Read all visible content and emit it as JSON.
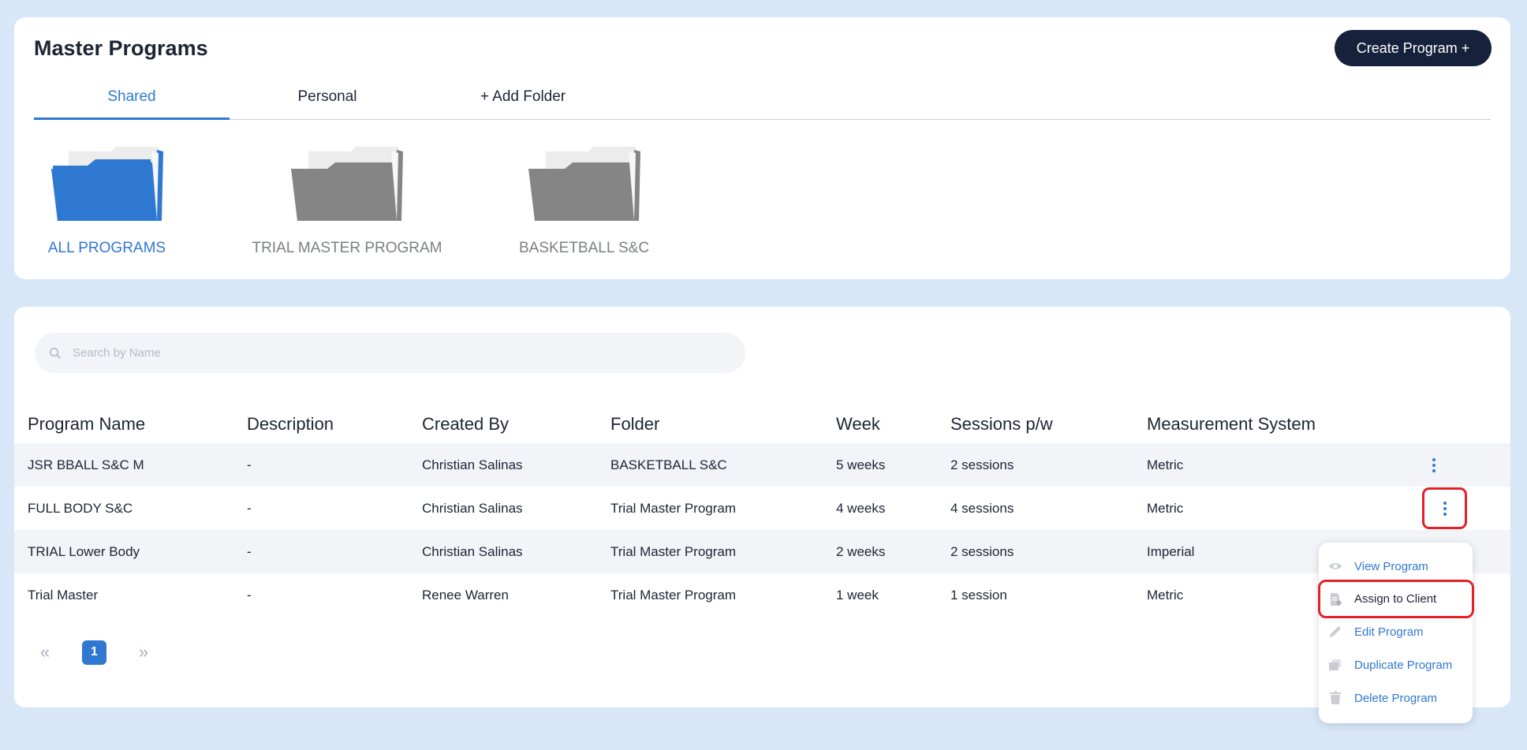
{
  "header": {
    "title": "Master Programs",
    "create_button": "Create Program +"
  },
  "tabs": [
    {
      "label": "Shared",
      "active": true
    },
    {
      "label": "Personal",
      "active": false
    },
    {
      "label": "+ Add Folder",
      "active": false
    }
  ],
  "folders": [
    {
      "label": "ALL PROGRAMS",
      "active": true
    },
    {
      "label": "TRIAL MASTER PROGRAM",
      "active": false
    },
    {
      "label": "BASKETBALL S&C",
      "active": false
    }
  ],
  "search": {
    "placeholder": "Search by Name",
    "value": ""
  },
  "table": {
    "columns": [
      "Program Name",
      "Description",
      "Created By",
      "Folder",
      "Week",
      "Sessions p/w",
      "Measurement System"
    ],
    "rows": [
      [
        "JSR BBALL S&C M",
        "-",
        "Christian Salinas",
        "BASKETBALL S&C",
        "5 weeks",
        "2 sessions",
        "Metric"
      ],
      [
        "FULL BODY S&C",
        "-",
        "Christian Salinas",
        "Trial Master Program",
        "4 weeks",
        "4 sessions",
        "Metric"
      ],
      [
        "TRIAL Lower Body",
        "-",
        "Christian Salinas",
        "Trial Master Program",
        "2 weeks",
        "2 sessions",
        "Imperial"
      ],
      [
        "Trial Master",
        "-",
        "Renee Warren",
        "Trial Master Program",
        "1 week",
        "1 session",
        "Metric"
      ]
    ]
  },
  "pagination": {
    "prev": "«",
    "current": "1",
    "next": "»"
  },
  "context_menu": {
    "items": [
      {
        "label": "View Program",
        "icon": "eye-icon"
      },
      {
        "label": "Assign to Client",
        "icon": "assign-document-icon"
      },
      {
        "label": "Edit Program",
        "icon": "pencil-icon"
      },
      {
        "label": "Duplicate Program",
        "icon": "duplicate-icon"
      },
      {
        "label": "Delete Program",
        "icon": "trash-icon"
      }
    ]
  },
  "colors": {
    "background": "#d8e7f7",
    "accent": "#2f78d2",
    "button_dark": "#16213b",
    "highlight_red": "#e32126",
    "folder_gray": "#858585"
  }
}
